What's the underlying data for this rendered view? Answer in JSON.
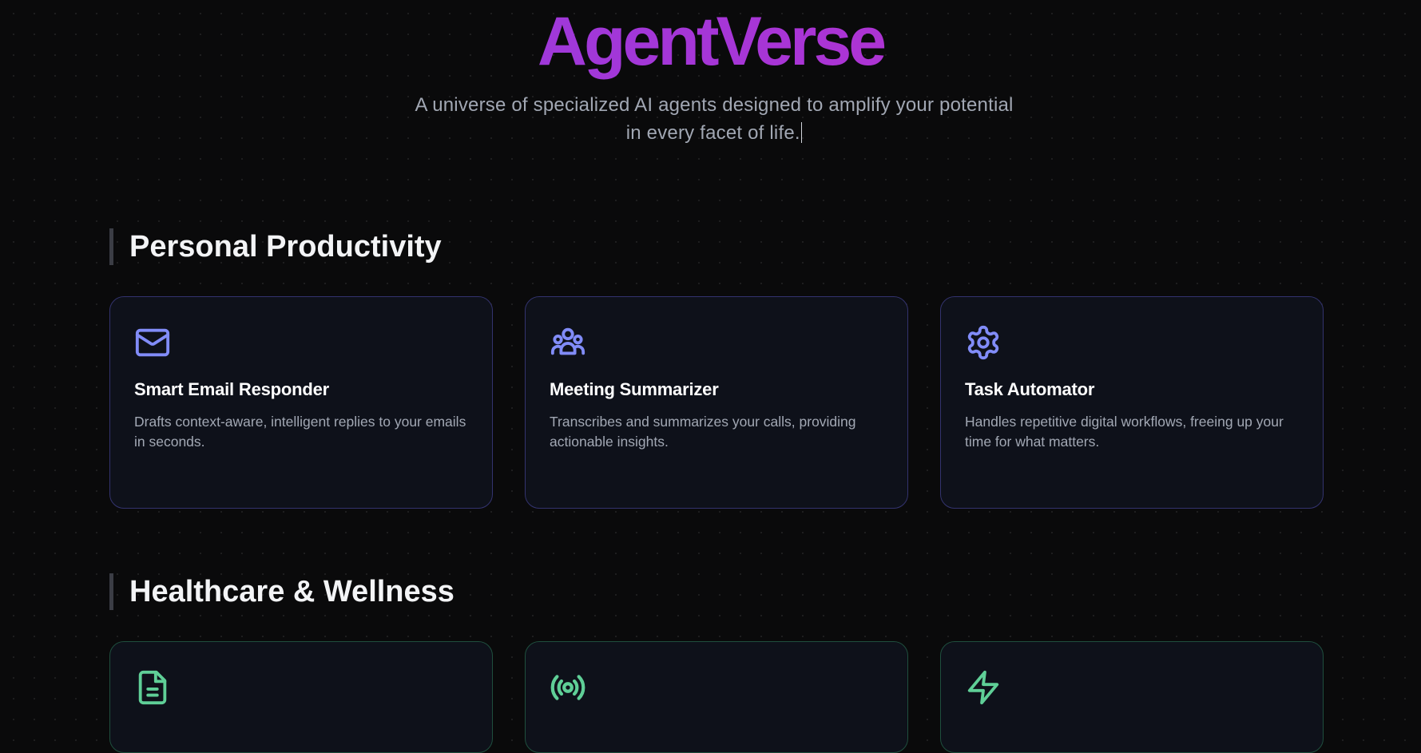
{
  "hero": {
    "title": "AgentVerse",
    "subtitle_line1": "A universe of specialized AI agents designed to amplify your potential",
    "subtitle_line2": "in every facet of life."
  },
  "colors": {
    "background": "#0a0a0b",
    "title_gradient_start": "#8b3fe0",
    "title_gradient_end": "#c72ec3",
    "productivity_accent": "#818cf8",
    "health_accent": "#5fcf97",
    "card_background": "#0e111a"
  },
  "sections": [
    {
      "title": "Personal Productivity",
      "cards": [
        {
          "icon": "mail-icon",
          "title": "Smart Email Responder",
          "description": "Drafts context-aware, intelligent replies to your emails in seconds."
        },
        {
          "icon": "users-icon",
          "title": "Meeting Summarizer",
          "description": "Transcribes and summarizes your calls, providing actionable insights."
        },
        {
          "icon": "gear-icon",
          "title": "Task Automator",
          "description": "Handles repetitive digital workflows, freeing up your time for what matters."
        }
      ]
    },
    {
      "title": "Healthcare & Wellness",
      "cards": [
        {
          "icon": "document-icon"
        },
        {
          "icon": "broadcast-icon"
        },
        {
          "icon": "lightning-icon"
        }
      ]
    }
  ]
}
